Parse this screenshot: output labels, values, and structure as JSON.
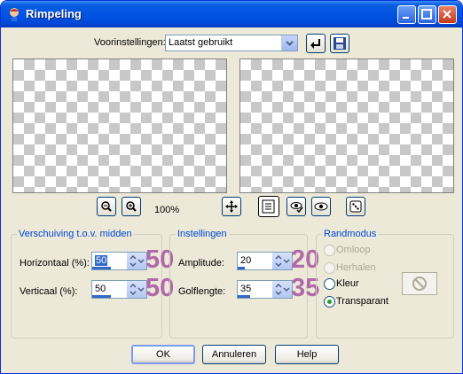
{
  "window": {
    "title": "Rimpeling"
  },
  "presets": {
    "label": "Voorinstellingen:",
    "value": "Laatst gebruikt"
  },
  "zoom": {
    "level": "100%"
  },
  "displacement": {
    "group_label": "Verschuiving t.o.v. midden",
    "horizontal": {
      "label": "Horizontaal (%):",
      "value": "50",
      "display": "50",
      "fill": 0.5
    },
    "vertical": {
      "label": "Verticaal (%):",
      "value": "50",
      "display": "50",
      "fill": 0.5
    }
  },
  "settings": {
    "group_label": "Instellingen",
    "amplitude": {
      "label": "Amplitude:",
      "value": "20",
      "display": "20",
      "fill": 0.2
    },
    "wavelength": {
      "label": "Golflengte:",
      "value": "35",
      "display": "35",
      "fill": 0.35
    }
  },
  "edge_mode": {
    "group_label": "Randmodus",
    "options": [
      "Omloop",
      "Herhalen",
      "Kleur",
      "Transparant"
    ],
    "selected": "Transparant"
  },
  "buttons": {
    "ok": "OK",
    "cancel": "Annuleren",
    "help": "Help"
  },
  "colors": {
    "accent": "#0046d5",
    "title_bar": "#0254e3",
    "highlight_numbers": "#b06aa9"
  }
}
